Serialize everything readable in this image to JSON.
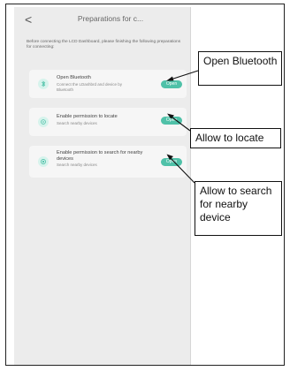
{
  "header": {
    "back_glyph": "<",
    "title": "Preparations for c..."
  },
  "intro": "Before connecting the LCD Dashboard, please finishing the following preparations for connecting:",
  "cards": [
    {
      "icon": "bluetooth-icon",
      "title": "Open Bluetooth",
      "subtitle": "Connect the LDashbrd and device by Bluetooth",
      "button": "Open"
    },
    {
      "icon": "location-icon",
      "title": "Enable permission to locate",
      "subtitle": "Search nearby devices",
      "button": "Open"
    },
    {
      "icon": "nearby-devices-icon",
      "title": "Enable permission to search for nearby devices",
      "subtitle": "Search nearby devices",
      "button": "Open"
    }
  ],
  "callouts": {
    "open_bluetooth": "Open Bluetooth",
    "locate": "Allow to locate",
    "search": "Allow to search for nearby device"
  },
  "colors": {
    "accent": "#4fc1a8",
    "background": "#ececec"
  }
}
